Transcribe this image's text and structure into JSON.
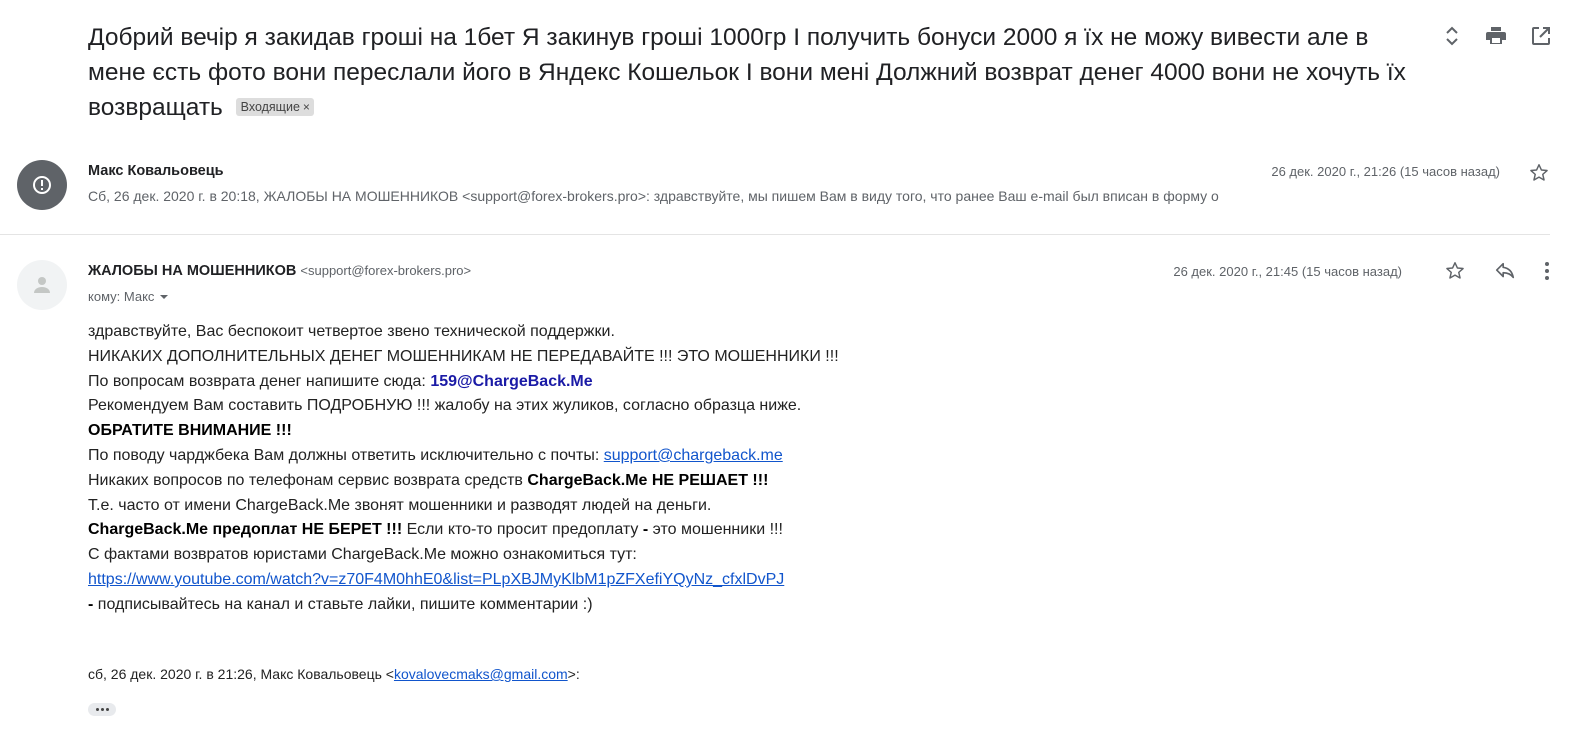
{
  "subject": {
    "text": "Добрий вечір я закидав гроші на 1бет Я закинув гроші 1000гр І получить бонуси 2000 я їх не можу вивести але в мене єсть фото вони переслали його в Яндекс Кошельок І вони мені Должний возврат денег 4000 вони не хочуть їх возвращать",
    "label": "Входящие",
    "label_close": "×"
  },
  "toolbar_icons": [
    "expand-collapse-icon",
    "print-icon",
    "open-new-window-icon"
  ],
  "message1": {
    "sender": "Макс Ковальовець",
    "date": "26 дек. 2020 г., 21:26 (15 часов назад)",
    "snippet": "Сб, 26 дек. 2020 г. в 20:18, ЖАЛОБЫ НА МОШЕННИКОВ <support@forex-brokers.pro>: здравствуйте, мы пишем Вам в виду того, что ранее Ваш e-mail был вписан в форму о"
  },
  "message2": {
    "sender_name": "ЖАЛОБЫ НА МОШЕННИКОВ",
    "sender_email": "<support@forex-brokers.pro>",
    "to": "кому: Макс",
    "date": "26 дек. 2020 г., 21:45 (15 часов назад)",
    "body": {
      "l1": "здравствуйте, Вас беспокоит четвертое звено технической поддержки.",
      "l2": "НИКАКИХ ДОПОЛНИТЕЛЬНЫХ ДЕНЕГ МОШЕННИКАМ НЕ ПЕРЕДАВАЙТЕ !!! ЭТО МОШЕННИКИ !!!",
      "l3_prefix": "По вопросам возврата денег напишите сюда: ",
      "l3_email": "159@ChargeBack.Me",
      "l4": "Рекомендуем Вам составить ПОДРОБНУЮ !!! жалобу на этих жуликов, согласно образца ниже.",
      "l5": "ОБРАТИТЕ ВНИМАНИЕ !!!",
      "l6_prefix": "По поводу чарджбека Вам должны ответить исключительно с почты: ",
      "l6_link": "support@chargeback.me",
      "l7_prefix": "Никаких вопросов по телефонам сервис возврата средств ",
      "l7_bold": "ChargeBack.Me НЕ РЕШАЕТ !!!",
      "l8": "Т.е. часто от имени ChargeBack.Me звонят мошенники и разводят людей на деньги.",
      "l9_bold1": "ChargeBack.Me предоплат НЕ БЕРЕТ !!!",
      "l9_mid": " Если кто-то просит предоплату ",
      "l9_dash": "-",
      "l9_end": " это мошенники !!!",
      "l10": "С фактами возвратов юристами ChargeBack.Me можно ознакомиться тут:",
      "l11_link": "https://www.youtube.com/watch?v=z70F4M0hhE0&list=PLpXBJMyKlbM1pZFXefiYQyNz_cfxlDvPJ",
      "l12_dash": " -",
      "l12_text": " подписывайтесь на канал и ставьте лайки, пишите комментарии :)"
    },
    "quote_prefix": "сб, 26 дек. 2020 г. в 21:26, Макс Ковальовець <",
    "quote_email": "kovalovecmaks@gmail.com",
    "quote_suffix": ">:"
  }
}
